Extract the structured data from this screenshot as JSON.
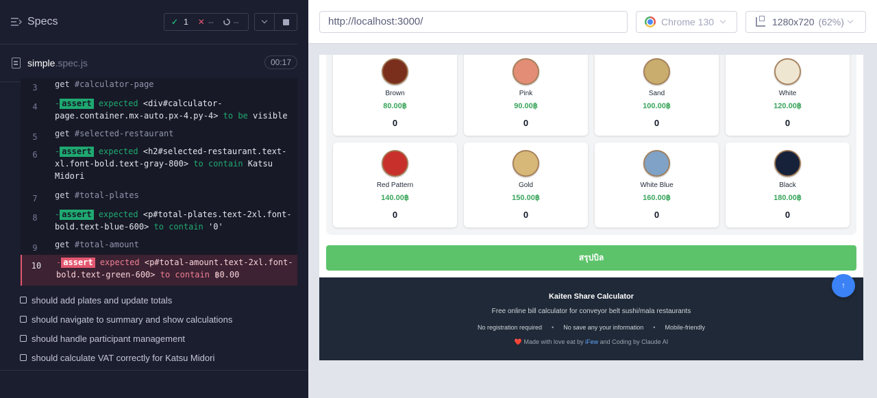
{
  "specs_header": {
    "title": "Specs",
    "passed_count": "1",
    "failed_count": "--",
    "pending_count": "--"
  },
  "file": {
    "name": "simple",
    "ext": ".spec.js",
    "duration": "00:17"
  },
  "commands": [
    {
      "line": "3",
      "name": "get",
      "selector": "#calculator-page"
    },
    {
      "line": "4",
      "type": "assert",
      "expected": "expected",
      "subject": "<div#calculator-page.container.mx-auto.px-4.py-4>",
      "matcher": "to be",
      "value": "visible"
    },
    {
      "line": "5",
      "name": "get",
      "selector": "#selected-restaurant"
    },
    {
      "line": "6",
      "type": "assert",
      "expected": "expected",
      "subject": "<h2#selected-restaurant.text-xl.font-bold.text-gray-800>",
      "matcher": "to contain",
      "value": "Katsu Midori"
    },
    {
      "line": "7",
      "name": "get",
      "selector": "#total-plates"
    },
    {
      "line": "8",
      "type": "assert",
      "expected": "expected",
      "subject": "<p#total-plates.text-2xl.font-bold.text-blue-600>",
      "matcher": "to contain",
      "value": "'0'"
    },
    {
      "line": "9",
      "name": "get",
      "selector": "#total-amount"
    },
    {
      "line": "10",
      "type": "assert",
      "expected": "expected",
      "subject": "<p#total-amount.text-2xl.font-bold.text-green-600>",
      "matcher": "to contain",
      "value": "฿0.00"
    }
  ],
  "assert_label": "assert",
  "tests": [
    "should add plates and update totals",
    "should navigate to summary and show calculations",
    "should handle participant management",
    "should calculate VAT correctly for Katsu Midori"
  ],
  "browser_bar": {
    "url": "http://localhost:3000/",
    "browser": "Chrome 130",
    "viewport": "1280x720",
    "zoom": "(62%)"
  },
  "plates": [
    {
      "name": "Brown",
      "price": "80.00฿",
      "count": "0",
      "color": "#7a2e1c"
    },
    {
      "name": "Pink",
      "price": "90.00฿",
      "count": "0",
      "color": "#e38d76"
    },
    {
      "name": "Sand",
      "price": "100.00฿",
      "count": "0",
      "color": "#c9ad6e"
    },
    {
      "name": "White",
      "price": "120.00฿",
      "count": "0",
      "color": "#efe6d2"
    },
    {
      "name": "Red Pattern",
      "price": "140.00฿",
      "count": "0",
      "color": "#c8302c"
    },
    {
      "name": "Gold",
      "price": "150.00฿",
      "count": "0",
      "color": "#d8b878"
    },
    {
      "name": "White Blue",
      "price": "160.00฿",
      "count": "0",
      "color": "#7fa2c6"
    },
    {
      "name": "Black",
      "price": "180.00฿",
      "count": "0",
      "color": "#16213a"
    }
  ],
  "summary_button": "สรุปบิล",
  "footer": {
    "title": "Kaiten Share Calculator",
    "subtitle": "Free online bill calculator for conveyor belt sushi/mala restaurants",
    "features": [
      "No registration required",
      "No save any your information",
      "Mobile-friendly"
    ],
    "credit_heart": "❤️",
    "credit_prefix": "Made with love eat by",
    "credit_link": "iFew",
    "credit_suffix": "and Coding by Claude AI"
  },
  "scroll_top_icon": "↑",
  "colors": {
    "pass": "#1fa971",
    "fail": "#e45770",
    "price_green": "#3aa55c",
    "summary_button": "#5cc36a",
    "footer_bg": "#1f2937"
  }
}
